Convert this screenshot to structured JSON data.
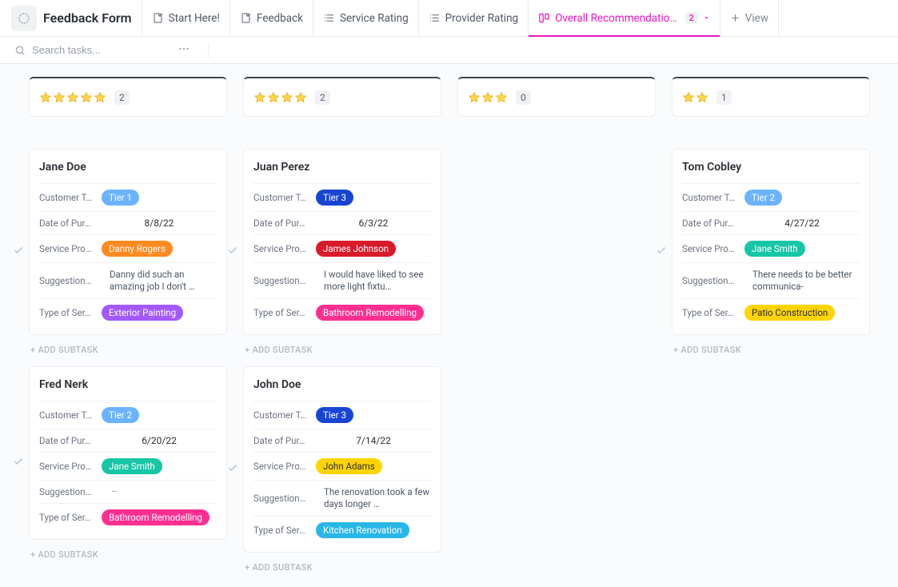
{
  "header": {
    "title": "Feedback Form",
    "tabs": [
      {
        "label": "Start Here!",
        "icon": "doc"
      },
      {
        "label": "Feedback",
        "icon": "doc"
      },
      {
        "label": "Service Rating",
        "icon": "list"
      },
      {
        "label": "Provider Rating",
        "icon": "list"
      },
      {
        "label": "Overall Recommendatio…",
        "icon": "board",
        "active": true,
        "count": "2"
      },
      {
        "label": "View",
        "icon": "plus"
      }
    ]
  },
  "search": {
    "placeholder": "Search tasks..."
  },
  "field_labels": {
    "tier": "Customer T…",
    "date": "Date of Pur…",
    "provider": "Service Pro…",
    "suggestion": "Suggestion…",
    "service": "Type of Ser…"
  },
  "add_subtask_label": "+ ADD SUBTASK",
  "empty_value": "–",
  "colors": {
    "tier1": "#4aa7ff",
    "tier2": "#6bb3ff",
    "tier2b": "#63a7f7",
    "tier3": "#1845d1",
    "danny": "#ff8a1f",
    "janeSmith": "#16c6a4",
    "james": "#d91a2a",
    "johnAdams": "#ffd400",
    "extPaint": "#a259ff",
    "bathroom": "#ff2f92",
    "kitchen": "#29b7e8",
    "patio": "#ffd400"
  },
  "columns": [
    {
      "stars": 5,
      "count": "2",
      "cards": [
        {
          "name": "Jane Doe",
          "tier": {
            "label": "Tier 1",
            "color": "#6bb3ff"
          },
          "date": "8/8/22",
          "provider": {
            "label": "Danny Rogers",
            "color": "#ff8a1f",
            "text": "#ffffff"
          },
          "suggestion": "Danny did such an amazing job I don't …",
          "service": {
            "label": "Exterior Painting",
            "color": "#a259ff",
            "text": "#ffffff"
          }
        },
        {
          "name": "Fred Nerk",
          "tier": {
            "label": "Tier 2",
            "color": "#6bb3ff"
          },
          "date": "6/20/22",
          "provider": {
            "label": "Jane Smith",
            "color": "#16c6a4",
            "text": "#ffffff"
          },
          "suggestion": "",
          "service": {
            "label": "Bathroom Remodelling",
            "color": "#ff2f92",
            "text": "#ffffff"
          }
        }
      ]
    },
    {
      "stars": 4,
      "count": "2",
      "cards": [
        {
          "name": "Juan Perez",
          "tier": {
            "label": "Tier 3",
            "color": "#1845d1"
          },
          "date": "6/3/22",
          "provider": {
            "label": "James Johnson",
            "color": "#d91a2a",
            "text": "#ffffff"
          },
          "suggestion": "I would have liked to see more light fixtu…",
          "service": {
            "label": "Bathroom Remodelling",
            "color": "#ff2f92",
            "text": "#ffffff"
          }
        },
        {
          "name": "John Doe",
          "tier": {
            "label": "Tier 3",
            "color": "#1845d1"
          },
          "date": "7/14/22",
          "provider": {
            "label": "John Adams",
            "color": "#ffd400",
            "text": "#2a2e34"
          },
          "suggestion": "The renovation took a few days longer …",
          "service": {
            "label": "Kitchen Renovation",
            "color": "#29b7e8",
            "text": "#ffffff"
          }
        }
      ]
    },
    {
      "stars": 3,
      "count": "0",
      "cards": []
    },
    {
      "stars": 2,
      "count": "1",
      "cards": [
        {
          "name": "Tom Cobley",
          "tier": {
            "label": "Tier 2",
            "color": "#6bb3ff"
          },
          "date": "4/27/22",
          "provider": {
            "label": "Jane Smith",
            "color": "#16c6a4",
            "text": "#ffffff"
          },
          "suggestion": "There needs to be better communica-",
          "service": {
            "label": "Patio Construction",
            "color": "#ffd400",
            "text": "#2a2e34"
          }
        }
      ]
    }
  ]
}
